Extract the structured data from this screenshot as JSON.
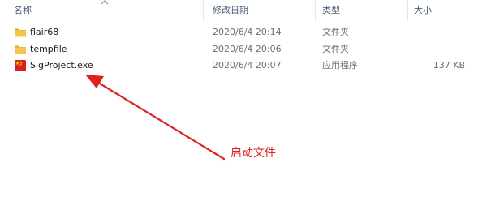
{
  "columns": {
    "name": "名称",
    "modified": "修改日期",
    "type": "类型",
    "size": "大小"
  },
  "files": [
    {
      "name": "flair68",
      "modified": "2020/6/4 20:14",
      "type": "文件夹",
      "size": "",
      "icon": "folder-icon"
    },
    {
      "name": "tempfile",
      "modified": "2020/6/4 20:06",
      "type": "文件夹",
      "size": "",
      "icon": "folder-icon"
    },
    {
      "name": "SigProject.exe",
      "modified": "2020/6/4 20:07",
      "type": "应用程序",
      "size": "137 KB",
      "icon": "app-icon"
    }
  ],
  "annotation": {
    "text": "启动文件",
    "color": "#e02020"
  },
  "colors": {
    "folder": "#f5c64d",
    "folder_dark": "#e2a92a",
    "header_text": "#4c607a"
  }
}
